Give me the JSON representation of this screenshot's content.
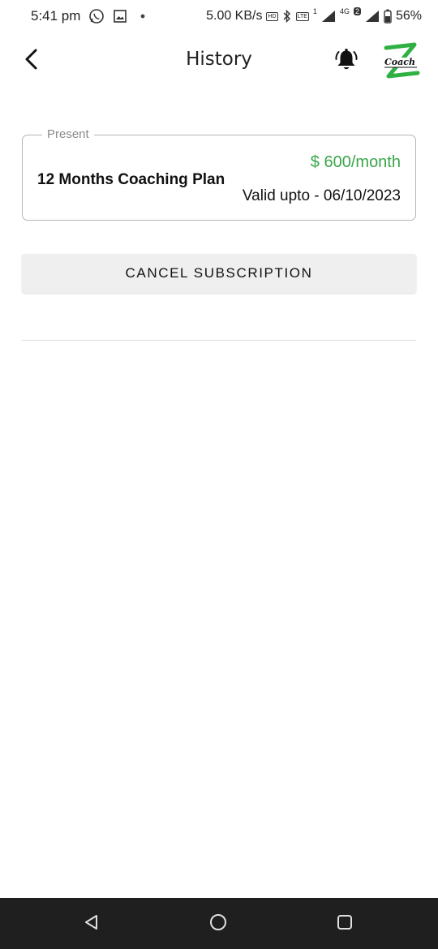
{
  "status_bar": {
    "time": "5:41 pm",
    "network_speed": "5.00 KB/s",
    "hd_badge": "HD",
    "sim1_badge": "1",
    "network_type": "4G",
    "sim2_badge": "2",
    "volte_badge": "LTE",
    "battery": "56%",
    "icons": [
      "whatsapp-icon",
      "gallery-icon",
      "dot-icon",
      "hd-icon",
      "bluetooth-icon",
      "volte-icon",
      "signal-icon",
      "battery-icon"
    ]
  },
  "header": {
    "title": "History",
    "back_icon": "chevron-left-icon",
    "bell_icon": "bell-ringing-icon",
    "logo_text": "Coach"
  },
  "plan": {
    "section_label": "Present",
    "price": "$ 600/month",
    "name": "12 Months Coaching Plan",
    "valid": "Valid upto - 06/10/2023"
  },
  "actions": {
    "cancel_label": "CANCEL SUBSCRIPTION"
  },
  "nav": {
    "icons": [
      "back-triangle-icon",
      "home-circle-icon",
      "recents-square-icon"
    ]
  },
  "colors": {
    "price": "#3aa54a",
    "logo_green": "#2fb043",
    "nav_bg": "#1f1f1f"
  }
}
